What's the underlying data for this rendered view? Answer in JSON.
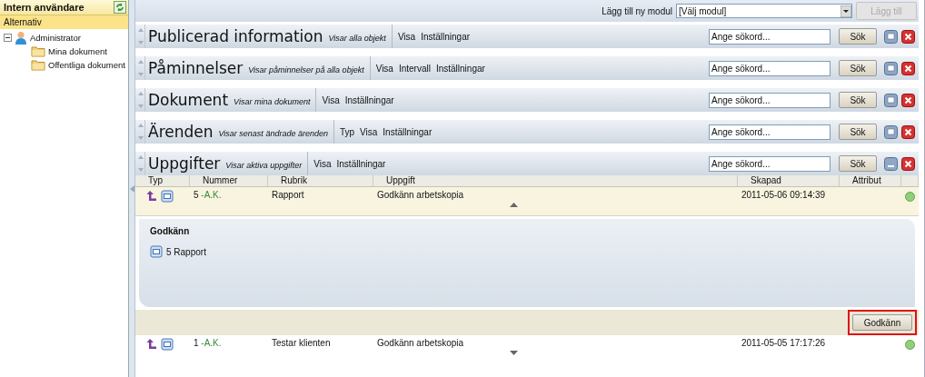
{
  "sidebar": {
    "title": "Intern användare",
    "section": "Alternativ",
    "tree": [
      {
        "label": "Administrator",
        "kind": "user",
        "expanded": true,
        "children": [
          {
            "label": "Mina dokument",
            "kind": "folder"
          },
          {
            "label": "Offentliga dokument",
            "kind": "folder"
          }
        ]
      }
    ]
  },
  "toolbar": {
    "label": "Lägg till ny modul",
    "select_value": "[Välj modul]",
    "add_button": {
      "label": "Lägg till",
      "disabled": true
    }
  },
  "modules": [
    {
      "title": "Publicerad information",
      "subtitle": "Visar alla objekt",
      "links": [
        "Visa",
        "Inställningar"
      ],
      "search_placeholder": "Ange sökord...",
      "search_button": "Sök",
      "expanded": false
    },
    {
      "title": "Påminnelser",
      "subtitle": "Visar påminnelser på alla objekt",
      "links": [
        "Visa",
        "Intervall",
        "Inställningar"
      ],
      "search_placeholder": "Ange sökord...",
      "search_button": "Sök",
      "expanded": false
    },
    {
      "title": "Dokument",
      "subtitle": "Visar mina dokument",
      "links": [
        "Visa",
        "Inställningar"
      ],
      "search_placeholder": "Ange sökord...",
      "search_button": "Sök",
      "expanded": false
    },
    {
      "title": "Ärenden",
      "subtitle": "Visar senast ändrade ärenden",
      "links": [
        "Typ",
        "Visa",
        "Inställningar"
      ],
      "search_placeholder": "Ange sökord...",
      "search_button": "Sök",
      "expanded": false
    },
    {
      "title": "Uppgifter",
      "subtitle": "Visar aktiva uppgifter",
      "links": [
        "Visa",
        "Inställningar"
      ],
      "search_placeholder": "Ange sökord...",
      "search_button": "Sök",
      "expanded": true,
      "table": {
        "columns": [
          "Typ",
          "Nummer",
          "Rubrik",
          "Uppgift",
          "Skapad",
          "Attribut"
        ],
        "rows": [
          {
            "number": "5",
            "tag": "-A.K.",
            "title": "Rapport",
            "task": "Godkänn arbetskopia",
            "created": "2011-05-06 09:14:39",
            "color": "#8fd07a",
            "expanded": true,
            "detail": {
              "heading": "Godkänn",
              "item": "5 Rapport",
              "button": {
                "label": "Godkänn",
                "highlighted": true
              }
            }
          },
          {
            "number": "1",
            "tag": "-A.K.",
            "title": "Testar klienten",
            "task": "Godkänn arbetskopia",
            "created": "2011-05-05 17:17:26",
            "color": "#8fd07a",
            "expanded": false
          }
        ]
      }
    }
  ]
}
